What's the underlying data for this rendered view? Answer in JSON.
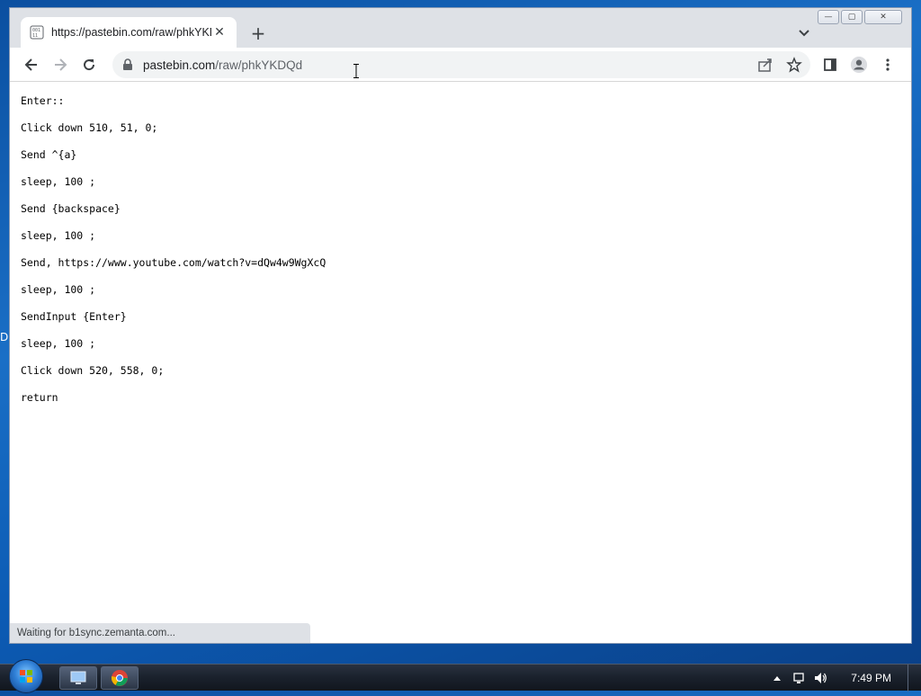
{
  "tab": {
    "title": "https://pastebin.com/raw/phkYKDQd",
    "close_glyph": "✕",
    "new_tab_glyph": "+"
  },
  "window_controls": {
    "minimize": "—",
    "maximize": "▢",
    "close": "✕"
  },
  "address_bar": {
    "host": "pastebin.com",
    "path": "/raw/phkYKDQd"
  },
  "page": {
    "lines": [
      "Enter::",
      "Click down 510, 51, 0;",
      "Send ^{a}",
      "sleep, 100 ;",
      "Send {backspace}",
      "sleep, 100 ;",
      "Send, https://www.youtube.com/watch?v=dQw4w9WgXcQ",
      "sleep, 100 ;",
      "SendInput {Enter}",
      "sleep, 100 ;",
      "Click down 520, 558, 0;",
      "return"
    ]
  },
  "status": {
    "text": "Waiting for b1sync.zemanta.com..."
  },
  "taskbar": {
    "clock": "7:49 PM"
  },
  "desktop": {
    "edge_char": "D"
  },
  "colors": {
    "tab_bg": "#ffffff",
    "chrome_bg": "#dee1e6",
    "omnibox_bg": "#f1f3f4",
    "taskbar_bg": "#1a212c"
  }
}
